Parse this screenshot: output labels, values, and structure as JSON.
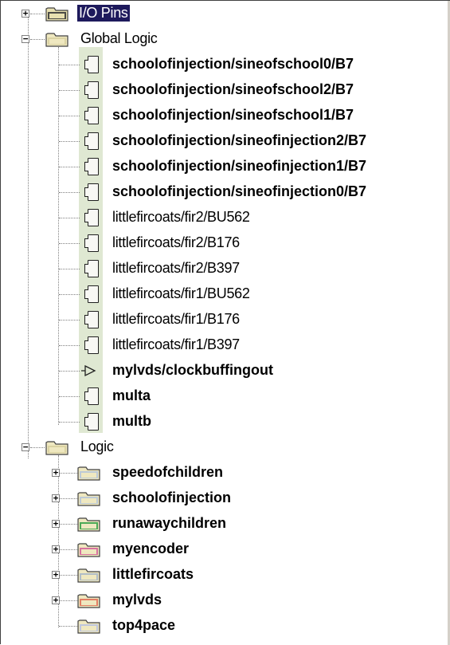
{
  "tree": {
    "io_pins": {
      "label": "I/O Pins",
      "expander": "+"
    },
    "global_logic": {
      "label": "Global Logic",
      "expander": "−",
      "items": [
        "schoolofinjection/sineofschool0/B7",
        "schoolofinjection/sineofschool2/B7",
        "schoolofinjection/sineofschool1/B7",
        "schoolofinjection/sineofinjection2/B7",
        "schoolofinjection/sineofinjection1/B7",
        "schoolofinjection/sineofinjection0/B7",
        "littlefircoats/fir2/BU562",
        "littlefircoats/fir2/B176",
        "littlefircoats/fir2/B397",
        "littlefircoats/fir1/BU562",
        "littlefircoats/fir1/B176",
        "littlefircoats/fir1/B397",
        "mylvds/clockbuffingout",
        "multa",
        "multb"
      ]
    },
    "logic": {
      "label": "Logic",
      "expander": "−",
      "items": [
        {
          "label": "speedofchildren",
          "expander": "+",
          "color": "#b7c6d8"
        },
        {
          "label": "schoolofinjection",
          "expander": "+",
          "color": "#b7c6d8"
        },
        {
          "label": "runawaychildren",
          "expander": "+",
          "color": "#3aa34a"
        },
        {
          "label": "myencoder",
          "expander": "+",
          "color": "#d4659a"
        },
        {
          "label": "littlefircoats",
          "expander": "+",
          "color": "#aab8c8"
        },
        {
          "label": "mylvds",
          "expander": "+",
          "color": "#e0735a"
        },
        {
          "label": "top4pace",
          "expander": "",
          "color": "#b9c2e0"
        }
      ]
    }
  },
  "colors": {
    "selection_bg": "#1e1a5c",
    "folder_fill": "#e8e0b0",
    "band_green": "#dfe8d2"
  }
}
